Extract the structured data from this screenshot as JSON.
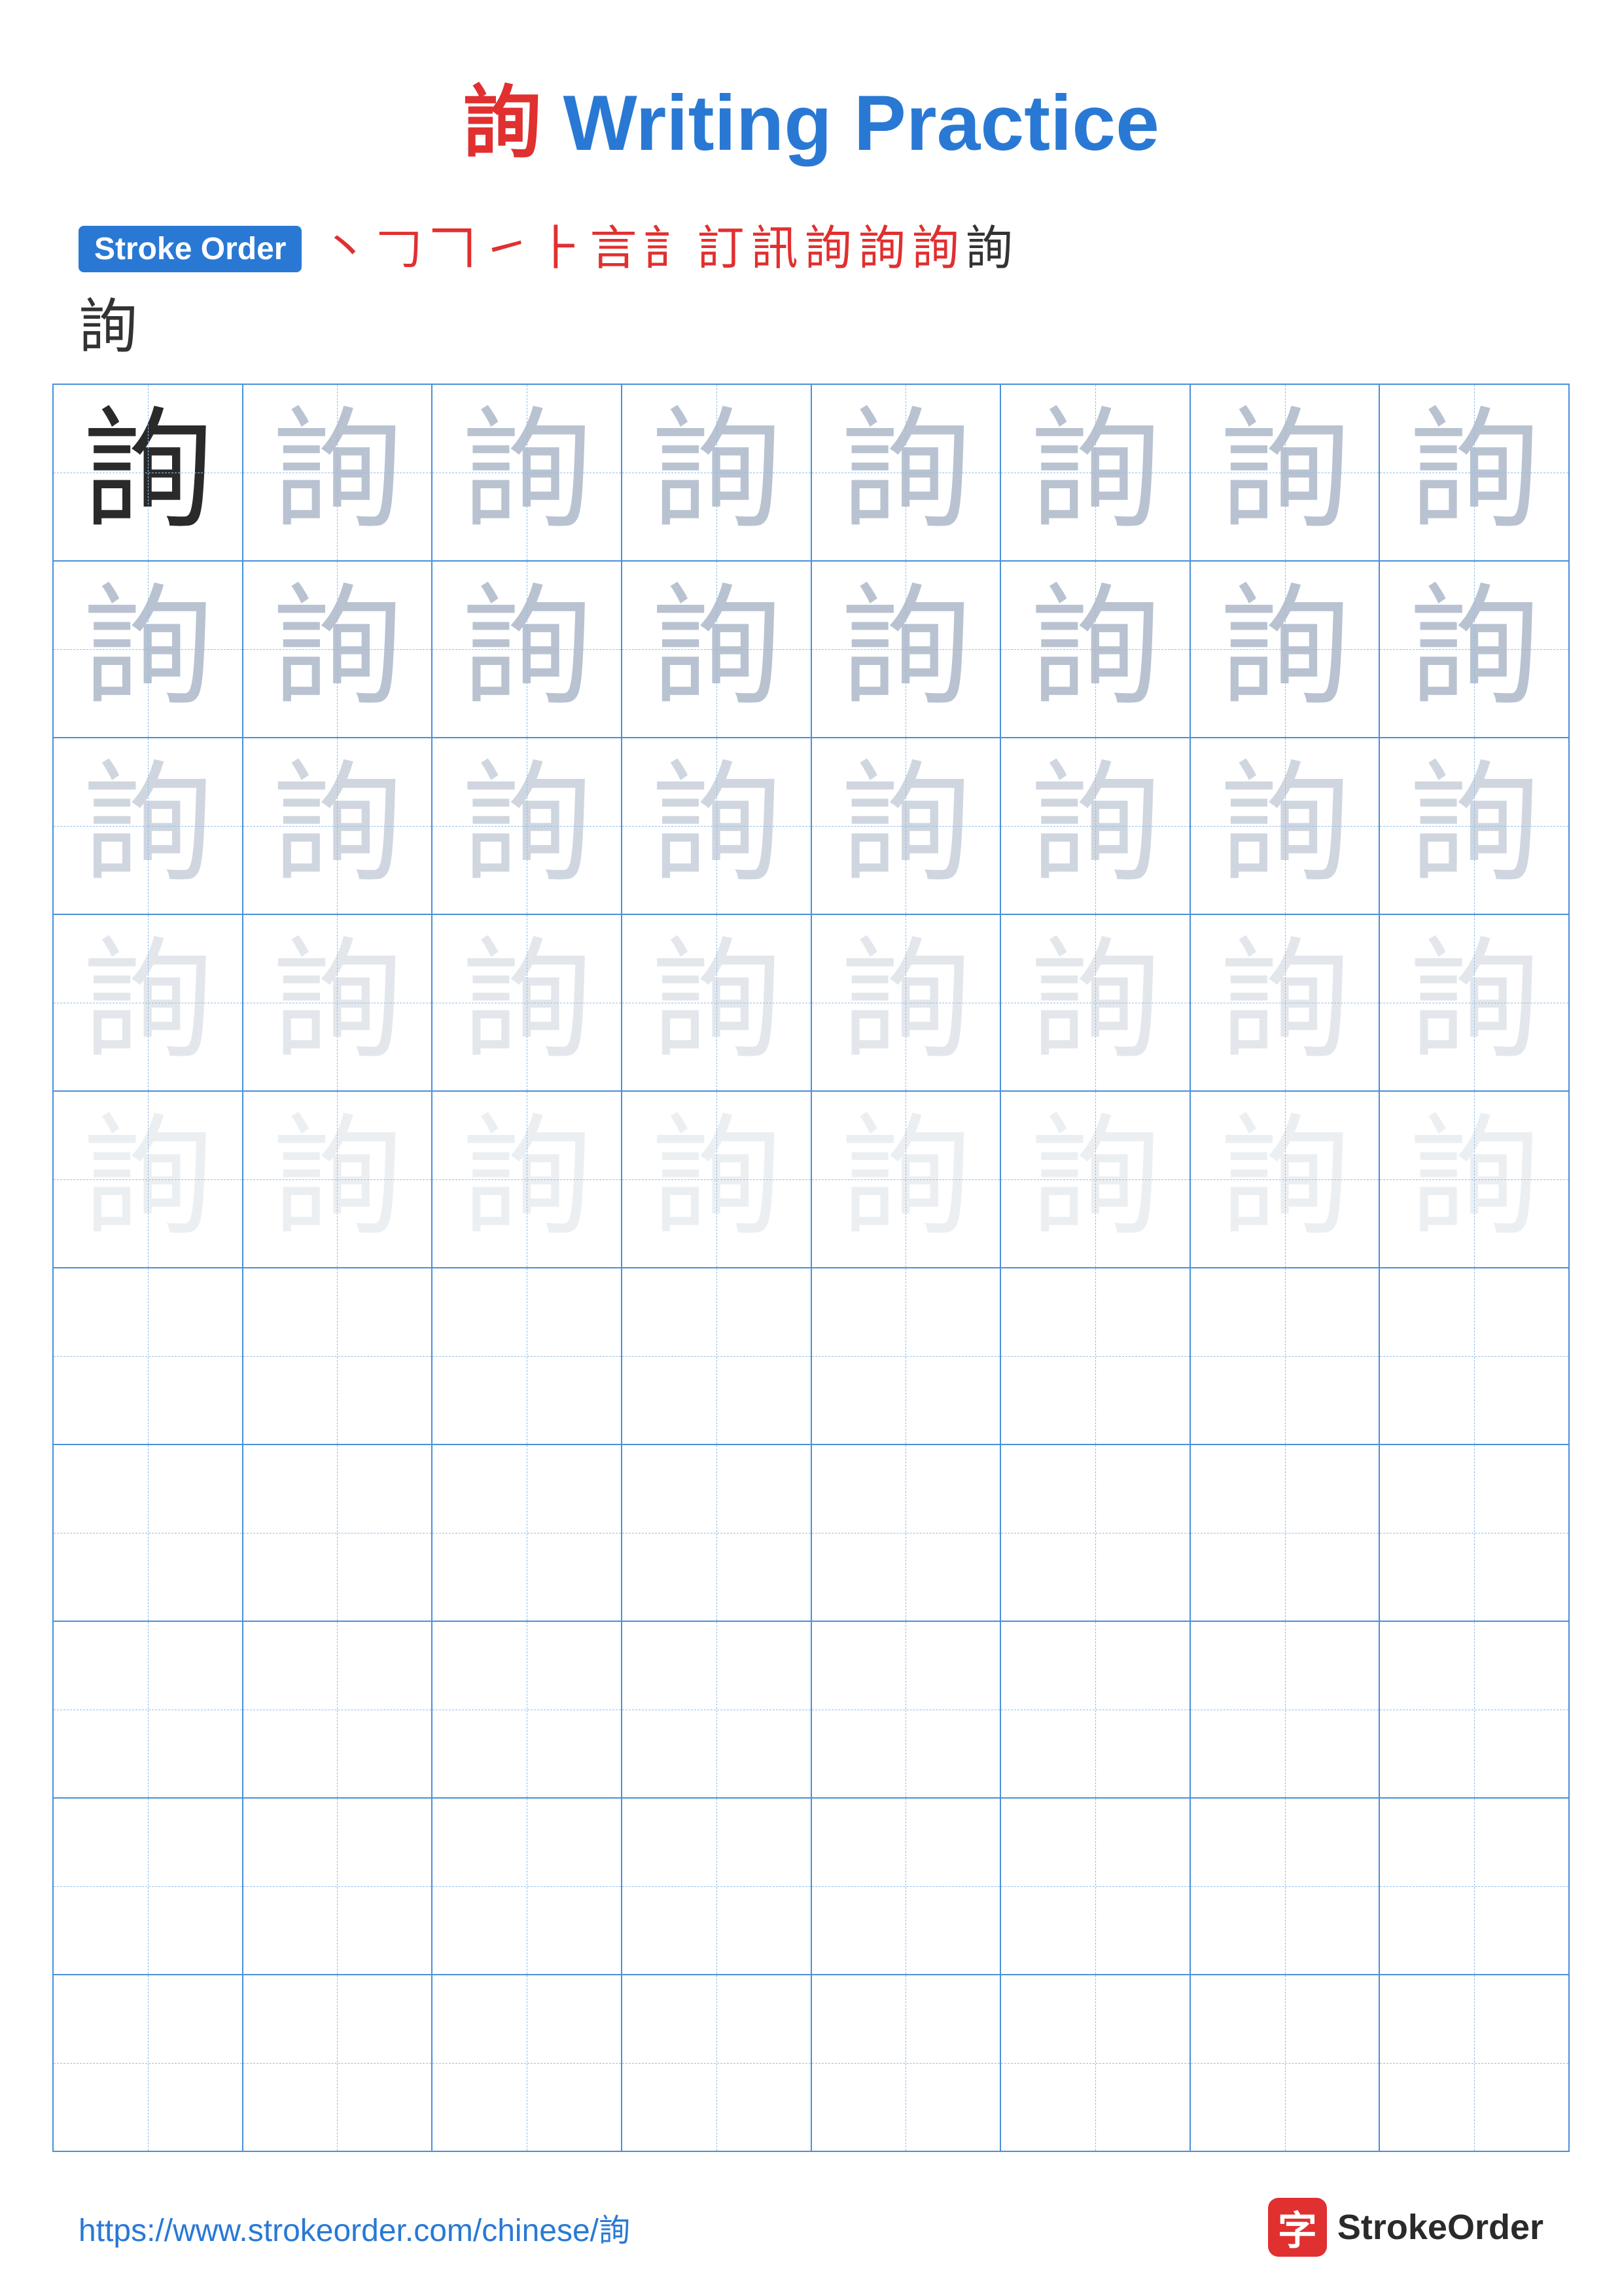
{
  "title": {
    "character": "詢",
    "text": " Writing Practice"
  },
  "stroke_order": {
    "badge_label": "Stroke Order",
    "strokes": [
      "丶",
      "𠃌",
      "𠃍",
      "㇀",
      "⺊",
      "言",
      "訁",
      "訂",
      "訊",
      "詢",
      "詢",
      "詢",
      "詢"
    ],
    "final_char": "詢"
  },
  "grid": {
    "character": "詢",
    "rows": 10,
    "cols": 8
  },
  "footer": {
    "url": "https://www.strokeorder.com/chinese/詢",
    "logo_char": "字",
    "logo_text": "StrokeOrder"
  }
}
